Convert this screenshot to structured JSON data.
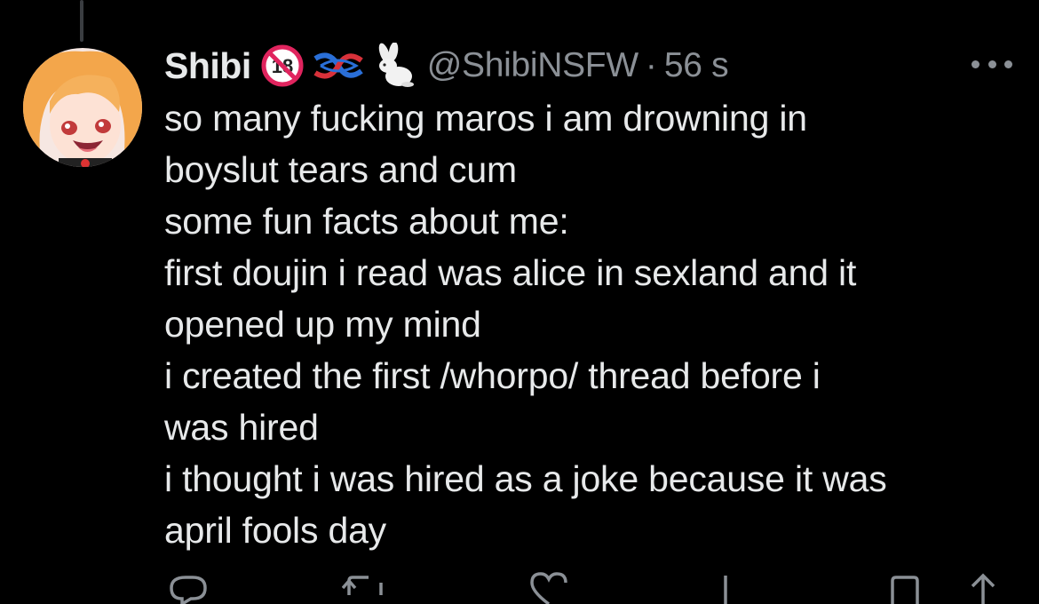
{
  "tweet": {
    "display_name": "Shibi",
    "handle": "@ShibiNSFW",
    "separator": "·",
    "time": "56 s",
    "badges": [
      "no-under-18-icon",
      "rope-knot-icon",
      "rabbit-icon"
    ],
    "lines": [
      "so many fucking maros i am drowning in",
      "boyslut tears and cum",
      "some fun facts about me:",
      "first doujin i read was alice in sexland and it",
      "opened up my mind",
      "i created the first /whorpo/ thread before i",
      "was hired",
      "i thought i was hired as a joke because it was",
      "april fools day"
    ]
  },
  "actions": [
    "reply-icon",
    "retweet-icon",
    "like-icon",
    "views-icon",
    "bookmark-icon",
    "share-icon"
  ],
  "colors": {
    "background": "#000000",
    "text": "#e7e9ea",
    "secondary": "#8b9096",
    "badge_red": "#e0245e",
    "thread_line": "#3a3d41"
  }
}
